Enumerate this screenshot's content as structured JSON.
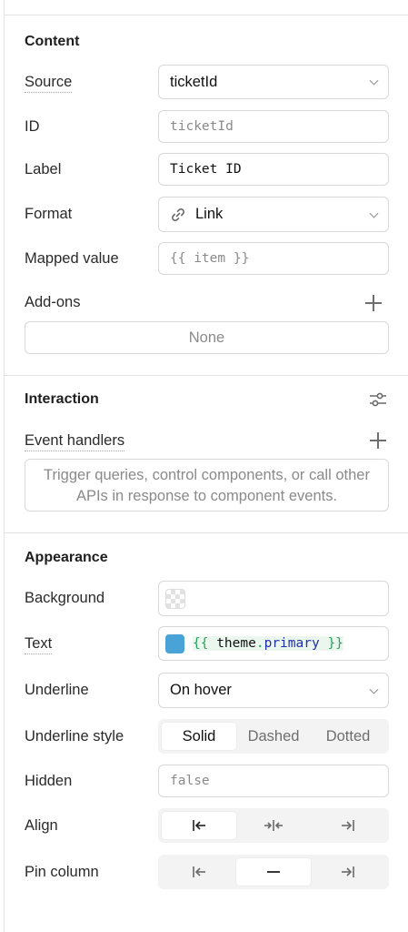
{
  "content": {
    "title": "Content",
    "source": {
      "label": "Source",
      "value": "ticketId"
    },
    "id": {
      "label": "ID",
      "placeholder": "ticketId"
    },
    "label": {
      "label": "Label",
      "value": "Ticket ID"
    },
    "format": {
      "label": "Format",
      "value": "Link",
      "icon": "link-icon"
    },
    "mapped_value": {
      "label": "Mapped value",
      "placeholder": "{{ item }}"
    },
    "addons": {
      "label": "Add-ons",
      "empty": "None"
    }
  },
  "interaction": {
    "title": "Interaction",
    "event_handlers": {
      "label": "Event handlers",
      "empty": "Trigger queries, control components, or call other APIs in response to component events."
    }
  },
  "appearance": {
    "title": "Appearance",
    "background": {
      "label": "Background"
    },
    "text": {
      "label": "Text",
      "open": "{{",
      "token": "theme",
      "dot": ".",
      "prop": "primary",
      "close": "}}",
      "swatch_color": "#4aa3d6"
    },
    "underline": {
      "label": "Underline",
      "value": "On hover"
    },
    "underline_style": {
      "label": "Underline style",
      "options": [
        "Solid",
        "Dashed",
        "Dotted"
      ],
      "selected": "Solid"
    },
    "hidden": {
      "label": "Hidden",
      "placeholder": "false"
    },
    "align": {
      "label": "Align",
      "options": [
        "align-left-icon",
        "align-center-icon",
        "align-right-icon"
      ],
      "selected": "align-left-icon"
    },
    "pin_column": {
      "label": "Pin column",
      "options": [
        "pin-left-icon",
        "pin-none-icon",
        "pin-right-icon"
      ],
      "selected": "pin-none-icon"
    }
  }
}
